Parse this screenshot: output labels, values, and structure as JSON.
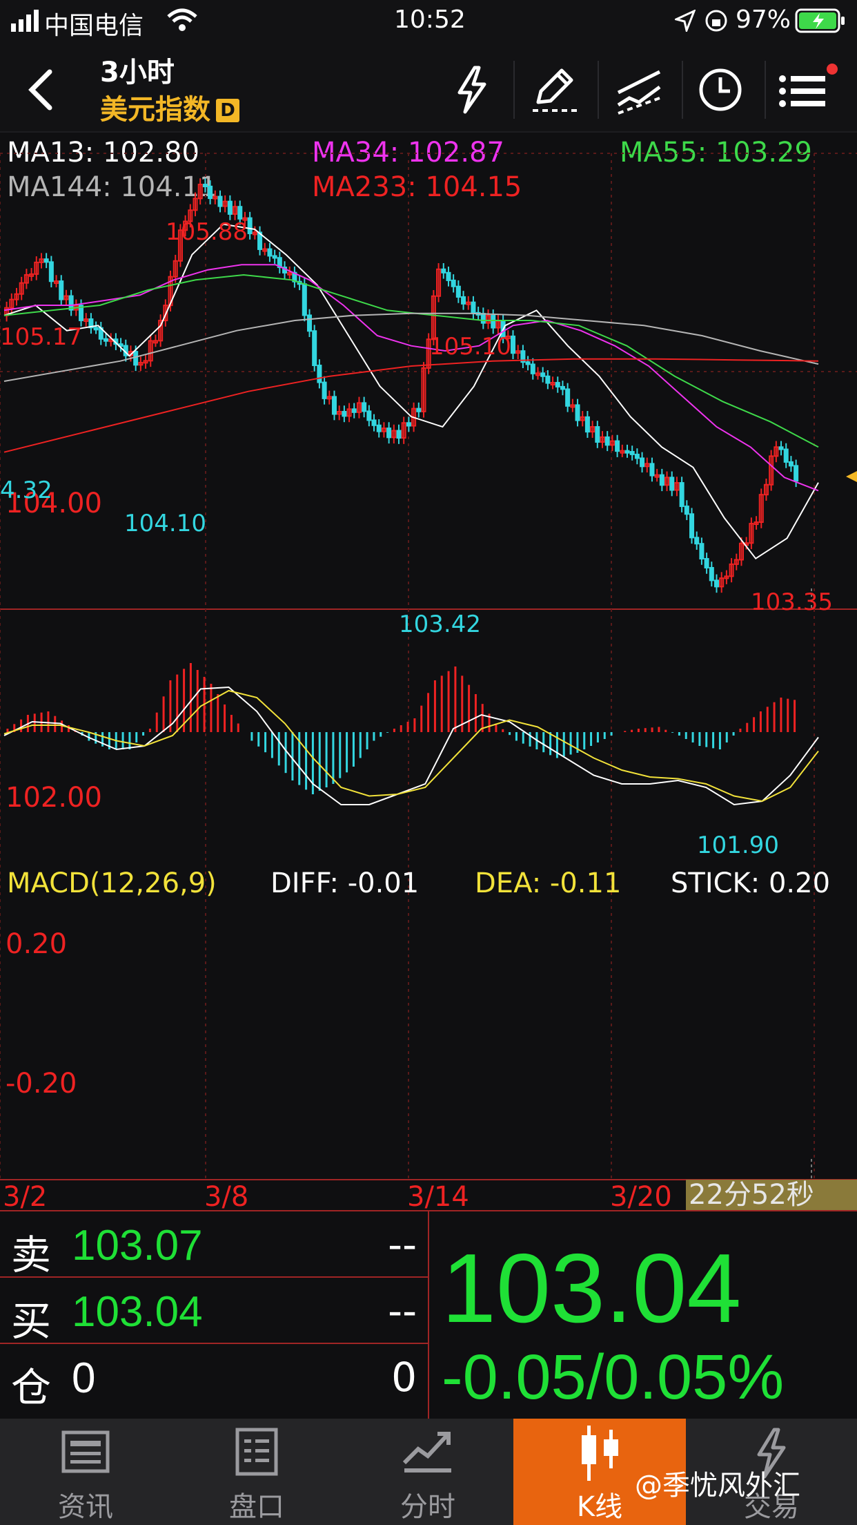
{
  "status_bar": {
    "carrier": "中国电信",
    "time": "10:52",
    "battery": "97%"
  },
  "header": {
    "timeframe": "3小时",
    "symbol": "美元指数",
    "badge": "D",
    "icons": [
      "back-icon",
      "lightning-icon",
      "pencil-icon",
      "drawing-tools-icon",
      "clock-icon",
      "menu-icon"
    ]
  },
  "ma_legend": [
    {
      "label": "MA13: 102.80",
      "color": "#ffffff"
    },
    {
      "label": "MA34: 102.87",
      "color": "#ee33ee"
    },
    {
      "label": "MA55: 103.29",
      "color": "#3ed94a"
    },
    {
      "label": "MA144: 104.11",
      "color": "#b5b5b5"
    },
    {
      "label": "MA233: 104.15",
      "color": "#ee2222"
    }
  ],
  "price_axis": {
    "labels": [
      "104.00",
      "102.00"
    ]
  },
  "price_annotations": {
    "high_left": "105.17",
    "high_peak": "105.88",
    "high_mid": "105.10",
    "low_mid": "104.10",
    "low_edge": "4.32",
    "low_center": "103.42",
    "high_right": "103.35",
    "low_bottom": "101.90"
  },
  "macd_legend": {
    "title": "MACD(12,26,9)",
    "diff": "DIFF: -0.01",
    "dea": "DEA: -0.11",
    "stick": "STICK: 0.20"
  },
  "macd_axis": {
    "labels": [
      "0.20",
      "-0.20"
    ]
  },
  "date_axis": {
    "labels": [
      "3/2",
      "3/8",
      "3/14",
      "3/20"
    ]
  },
  "countdown": "22分52秒",
  "quote": {
    "sell_label": "卖",
    "sell_price": "103.07",
    "sell_vol": "--",
    "buy_label": "买",
    "buy_price": "103.04",
    "buy_vol": "--",
    "pos_label": "仓",
    "pos_value": "0",
    "pos_right": "0",
    "last_price": "103.04",
    "change": "-0.05/0.05%"
  },
  "tabs": [
    {
      "label": "资讯",
      "icon": "news-icon"
    },
    {
      "label": "盘口",
      "icon": "orderbook-icon"
    },
    {
      "label": "分时",
      "icon": "timeshare-icon"
    },
    {
      "label": "K线",
      "icon": "candlestick-icon",
      "active": true
    },
    {
      "label": "交易",
      "icon": "trade-icon"
    }
  ],
  "watermark": "@季忧风外汇",
  "colors": {
    "up": "#ee2222",
    "down": "#33d6e0",
    "green": "#1fe036",
    "accent": "#e8640f",
    "gold": "#f3b726"
  },
  "chart_data": {
    "type": "candlestick",
    "title": "",
    "ylim": [
      101.7,
      106.2
    ],
    "series": [
      {
        "name": "MA13",
        "values": [
          104.6,
          104.7,
          104.45,
          104.5,
          104.2,
          104.5,
          105.2,
          105.5,
          105.45,
          105.2,
          104.9,
          104.4,
          103.9,
          103.6,
          103.5,
          103.9,
          104.5,
          104.65,
          104.3,
          104.0,
          103.6,
          103.3,
          103.1,
          102.6,
          102.2,
          102.4,
          102.95
        ]
      },
      {
        "name": "MA34",
        "values": [
          104.65,
          104.7,
          104.7,
          104.75,
          104.8,
          104.95,
          105.05,
          105.1,
          105.1,
          104.95,
          104.7,
          104.4,
          104.3,
          104.25,
          104.3,
          104.5,
          104.55,
          104.45,
          104.3,
          104.1,
          103.8,
          103.5,
          103.3,
          103.0,
          102.87
        ]
      },
      {
        "name": "MA55",
        "values": [
          104.6,
          104.65,
          104.7,
          104.85,
          104.95,
          105.0,
          104.95,
          104.8,
          104.65,
          104.6,
          104.55,
          104.55,
          104.5,
          104.3,
          104.0,
          103.75,
          103.55,
          103.3
        ]
      },
      {
        "name": "MA144",
        "values": [
          103.95,
          104.05,
          104.15,
          104.3,
          104.45,
          104.55,
          104.6,
          104.62,
          104.62,
          104.6,
          104.55,
          104.5,
          104.4,
          104.25,
          104.12
        ]
      },
      {
        "name": "MA233",
        "values": [
          103.25,
          103.45,
          103.65,
          103.85,
          104.0,
          104.1,
          104.15,
          104.17,
          104.17,
          104.16,
          104.15
        ]
      }
    ],
    "highs": [
      "105.17",
      "105.88",
      "105.10",
      "103.35"
    ],
    "lows": [
      "104.10",
      "103.42",
      "101.90"
    ]
  }
}
